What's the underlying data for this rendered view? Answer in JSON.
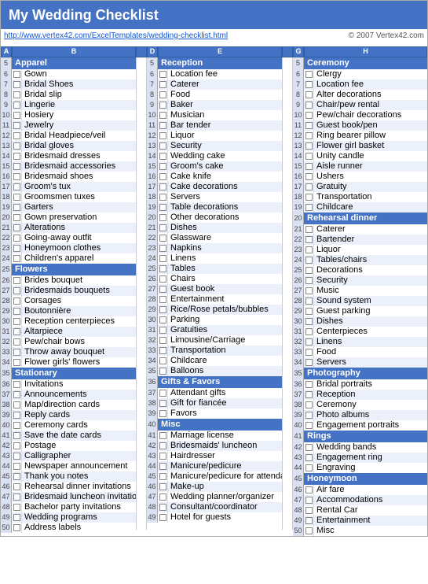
{
  "title": "My Wedding Checklist",
  "link": "http://www.vertex42.com/ExcelTemplates/wedding-checklist.html",
  "copyright": "© 2007 Vertex42.com",
  "sections": {
    "col1": [
      {
        "header": "Apparel",
        "items": [
          "Gown",
          "Bridal Shoes",
          "Bridal slip",
          "Lingerie",
          "Hosiery",
          "Jewelry",
          "Bridal Headpiece/veil",
          "Bridal gloves",
          "Bridesmaid dresses",
          "Bridesmaid accessories",
          "Bridesmaid shoes",
          "Groom's tux",
          "Groomsmen tuxes",
          "Garters",
          "Gown preservation",
          "Alterations",
          "Going-away outfit",
          "Honeymoon clothes",
          "Children's apparel"
        ]
      },
      {
        "header": "Flowers",
        "items": [
          "Brides bouquet",
          "Bridesmaids bouquets",
          "Corsages",
          "Boutonnière",
          "Reception centerpieces",
          "Altarpiece",
          "Pew/chair bows",
          "Throw away bouquet",
          "Flower girls' flowers"
        ]
      },
      {
        "header": "Stationary",
        "items": [
          "Invitations",
          "Announcements",
          "Map/direction cards",
          "Reply cards",
          "Ceremony cards",
          "Save the date cards",
          "Postage",
          "Calligrapher",
          "Newspaper announcement",
          "Thank you notes",
          "Rehearsal dinner invitations",
          "Bridesmaid luncheon invitations",
          "Bachelor party invitations",
          "Wedding programs",
          "Address labels"
        ]
      }
    ],
    "col2": [
      {
        "header": "Reception",
        "items": [
          "Location fee",
          "Caterer",
          "Food",
          "Baker",
          "Musician",
          "Bar tender",
          "Liquor",
          "Security",
          "Wedding cake",
          "Groom's cake",
          "Cake knife",
          "Cake decorations",
          "Servers",
          "Table decorations",
          "Other decorations",
          "Dishes",
          "Glassware",
          "Napkins",
          "Linens",
          "Tables",
          "Chairs",
          "Guest book",
          "Entertainment",
          "Rice/Rose petals/bubbles",
          "Parking",
          "Gratuities",
          "Limousine/Carriage",
          "Transportation",
          "Childcare",
          "Balloons"
        ]
      },
      {
        "header": "Gifts & Favors",
        "items": [
          "Attendant gifts",
          "Gift for fiancée",
          "Favors"
        ]
      },
      {
        "header": "Misc",
        "items": [
          "Marriage license",
          "Bridesmaids' luncheon",
          "Hairdresser",
          "Manicure/pedicure",
          "Manicure/pedicure for attendants",
          "Make-up",
          "Wedding planner/organizer",
          "Consultant/coordinator",
          "Hotel for guests"
        ]
      }
    ],
    "col3": [
      {
        "header": "Ceremony",
        "items": [
          "Clergy",
          "Location fee",
          "Alter decorations",
          "Chair/pew rental",
          "Pew/chair decorations",
          "Guest book/pen",
          "Ring bearer pillow",
          "Flower girl basket",
          "Unity candle",
          "Aisle runner",
          "Ushers",
          "Gratuity",
          "Transportation",
          "Childcare"
        ]
      },
      {
        "header": "Rehearsal dinner",
        "items": [
          "Caterer",
          "Bartender",
          "Liquor",
          "Tables/chairs",
          "Decorations",
          "Security",
          "Music",
          "Sound system",
          "Guest parking",
          "Dishes",
          "Centerpieces",
          "Linens",
          "Food",
          "Servers"
        ]
      },
      {
        "header": "Photography",
        "items": [
          "Bridal portraits",
          "Reception",
          "Ceremony",
          "Photo albums",
          "Engagement portraits"
        ]
      },
      {
        "header": "Rings",
        "items": [
          "Wedding bands",
          "Engagement ring",
          "Engraving"
        ]
      },
      {
        "header": "Honeymoon",
        "items": [
          "Air fare",
          "Accommodations",
          "Rental Car",
          "Entertainment",
          "Misc"
        ]
      }
    ]
  }
}
